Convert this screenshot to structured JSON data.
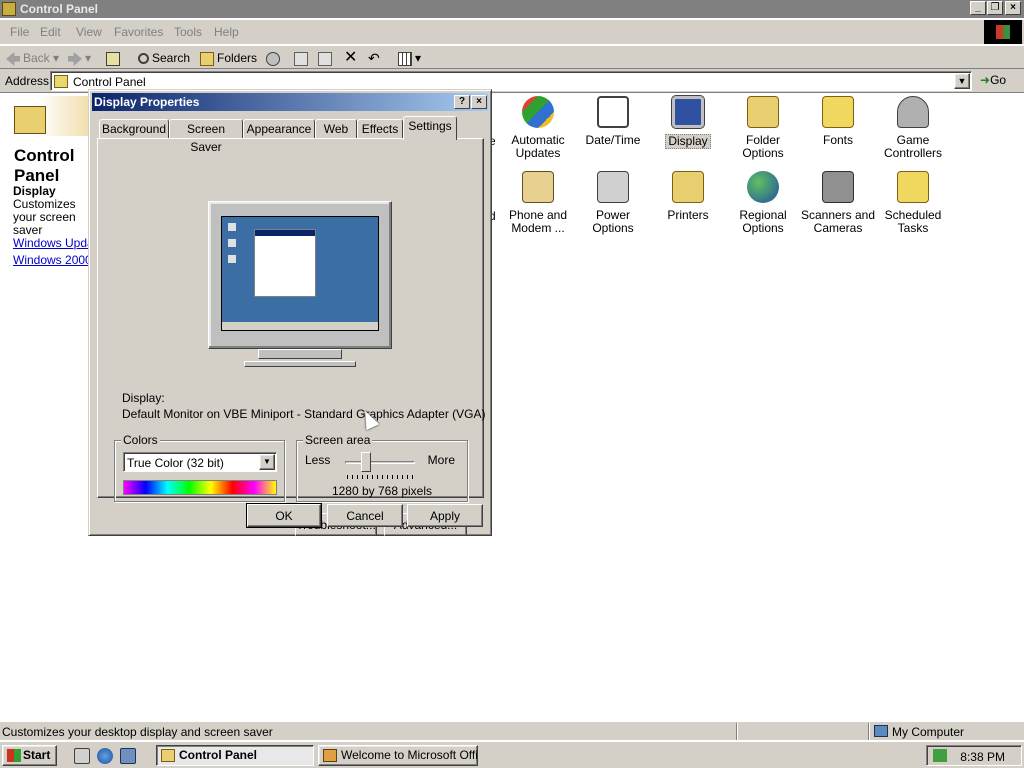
{
  "window": {
    "title": "Control Panel"
  },
  "menu": [
    "File",
    "Edit",
    "View",
    "Favorites",
    "Tools",
    "Help"
  ],
  "toolbar": {
    "back": "Back",
    "search": "Search",
    "folders": "Folders"
  },
  "address": {
    "label": "Address",
    "value": "Control Panel",
    "go": "Go"
  },
  "left_pane": {
    "title": "Control Panel",
    "selected_title": "Display",
    "selected_desc": "Customizes your screen saver",
    "links": [
      "Windows Update",
      "Windows 2000 Support"
    ]
  },
  "icons": {
    "row1": [
      {
        "label": "Automatic Updates",
        "icon": "automatic-updates-icon"
      },
      {
        "label": "Date/Time",
        "icon": "calendar-clock-icon"
      },
      {
        "label": "Display",
        "icon": "monitor-icon"
      },
      {
        "label": "Folder Options",
        "icon": "folder-options-icon"
      },
      {
        "label": "Fonts",
        "icon": "fonts-folder-icon"
      },
      {
        "label": "Game Controllers",
        "icon": "joystick-icon"
      }
    ],
    "row2": [
      {
        "label": "Phone and Modem ...",
        "icon": "phone-icon"
      },
      {
        "label": "Power Options",
        "icon": "power-plug-icon"
      },
      {
        "label": "Printers",
        "icon": "printer-folder-icon"
      },
      {
        "label": "Regional Options",
        "icon": "globe-icon"
      },
      {
        "label": "Scanners and Cameras",
        "icon": "scanner-camera-icon"
      },
      {
        "label": "Scheduled Tasks",
        "icon": "scheduled-tasks-icon"
      }
    ],
    "partial_e": "e",
    "partial_d": "d"
  },
  "dialog": {
    "title": "Display Properties",
    "help_btn": "?",
    "close_btn": "×",
    "tabs": [
      "Background",
      "Screen Saver",
      "Appearance",
      "Web",
      "Effects",
      "Settings"
    ],
    "active_tab": "Settings",
    "display_label": "Display:",
    "display_value": "Default Monitor on VBE Miniport - Standard Graphics Adapter (VGA)",
    "colors": {
      "legend": "Colors",
      "value": "True Color (32 bit)"
    },
    "screen_area": {
      "legend": "Screen area",
      "less": "Less",
      "more": "More",
      "value": "1280 by 768 pixels"
    },
    "troubleshoot": "Troubleshoot...",
    "advanced": "Advanced...",
    "ok": "OK",
    "cancel": "Cancel",
    "apply": "Apply"
  },
  "statusbar": {
    "text": "Customizes your desktop display and screen saver",
    "zone": "My Computer"
  },
  "taskbar": {
    "start": "Start",
    "tasks": [
      "Control Panel",
      "Welcome to Microsoft Offi..."
    ],
    "clock": "8:38 PM"
  }
}
